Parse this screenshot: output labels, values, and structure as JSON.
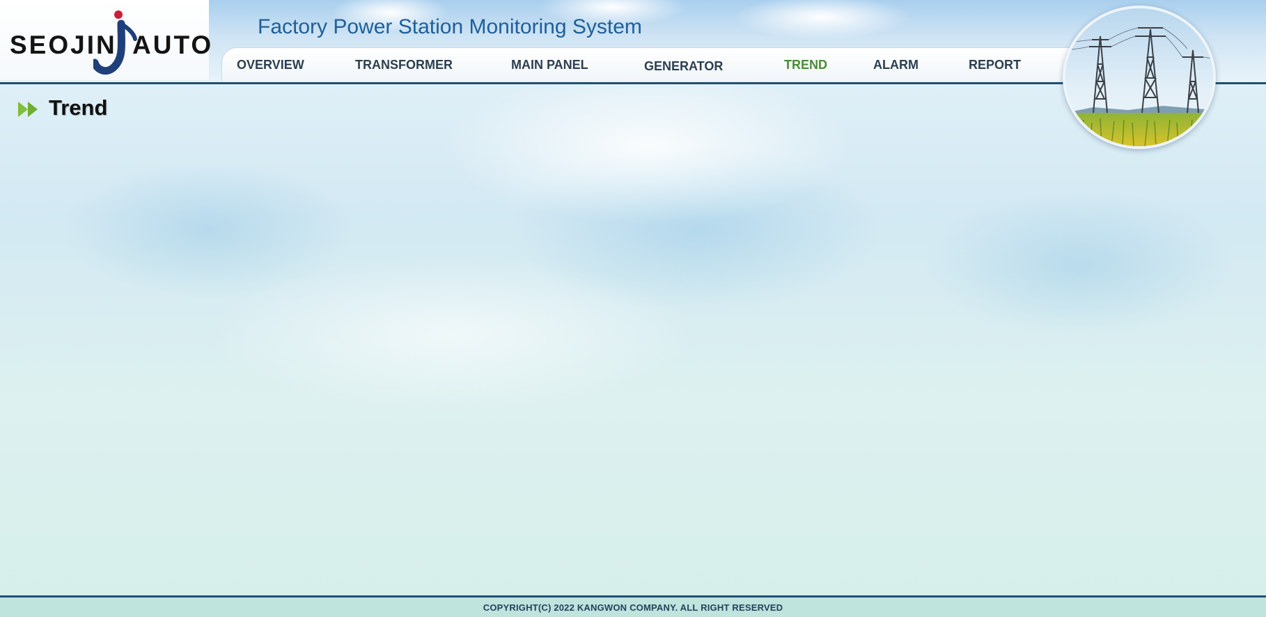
{
  "brand": {
    "logo_left": "SEOJIN",
    "logo_right": "AUTO",
    "accent_color": "#1f3f7a",
    "dot_color": "#c8203a"
  },
  "header": {
    "title": "Factory Power Station Monitoring System",
    "emblem": "transmission-tower-photo"
  },
  "nav": {
    "items": [
      {
        "label": "OVERVIEW"
      },
      {
        "label": "TRANSFORMER"
      },
      {
        "label": "MAIN PANEL"
      },
      {
        "label": "GENERATOR"
      },
      {
        "label": "TREND"
      },
      {
        "label": "ALARM"
      },
      {
        "label": "REPORT"
      }
    ],
    "active_color": "#4a8b3a",
    "text_color": "#2c3e50"
  },
  "page": {
    "title": "Trend",
    "title_icon": "double-arrow-right-icon"
  },
  "footer": {
    "text": "COPYRIGHT(C) 2022 KANGWON COMPANY. ALL RIGHT RESERVED"
  }
}
